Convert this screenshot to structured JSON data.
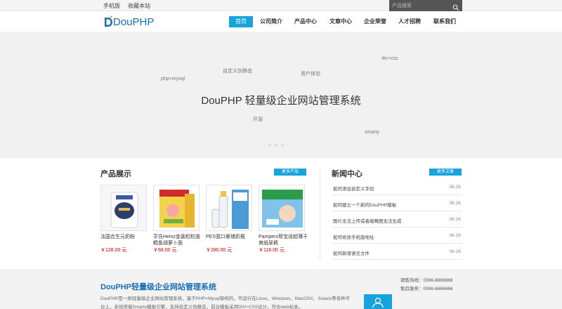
{
  "topbar": {
    "mobile_label": "手机版",
    "favorite_label": "收藏本站",
    "search_placeholder": "产品搜索"
  },
  "logo": {
    "text": "DouPHP"
  },
  "nav": [
    {
      "label": "首页",
      "active": true
    },
    {
      "label": "公司简介"
    },
    {
      "label": "产品中心"
    },
    {
      "label": "文章中心"
    },
    {
      "label": "企业荣誉"
    },
    {
      "label": "人才招聘"
    },
    {
      "label": "联系我们"
    }
  ],
  "banner": {
    "title": "DouPHP 轻量级企业网站管理系统",
    "tags": [
      "div+css",
      "自定义伪静态",
      "用户体验",
      "php+mysql",
      "开源",
      "smarty"
    ]
  },
  "products": {
    "title": "产品展示",
    "more_label": "更多产品",
    "items": [
      {
        "name": "法国合生元奶粉",
        "price": "￥128.00 元"
      },
      {
        "name": "亨氏Heinz金装粒粒面鳕鱼胡萝卜面",
        "price": "￥68.00 元"
      },
      {
        "name": "PES宽口奢储奶瓶",
        "price": "￥280.00 元"
      },
      {
        "name": "Pampers帮宝适超薄干爽纸尿裤",
        "price": "￥118.00 元"
      }
    ]
  },
  "news": {
    "title": "新闻中心",
    "more_label": "更多文章",
    "items": [
      {
        "title": "如何添加自定义字段",
        "date": "06-26"
      },
      {
        "title": "如何建立一个新的DouPHP模板",
        "date": "06-26"
      },
      {
        "title": "图片无法上传或者缩略图无法生成",
        "date": "06-26"
      },
      {
        "title": "如何修改手机版地址",
        "date": "06-26"
      },
      {
        "title": "如何新增语言文件",
        "date": "06-26"
      }
    ]
  },
  "footer": {
    "title": "DouPHP轻量级企业网站管理系统",
    "desc1": "DouPHP是一款轻量级企业网站管理系统，基于PHP+Mysql架构的，可运行在Linux、Windows、MacOSX、Solaris等各种平",
    "desc2": "台上，系统搭载Smarty模板引擎，支持自定义伪静态，前台模板采用DIV+CSS设计，符合web标准。",
    "sales_hotline": "销售热线：0596-8888888",
    "service_hotline": "售后服务：0596-6666666"
  }
}
